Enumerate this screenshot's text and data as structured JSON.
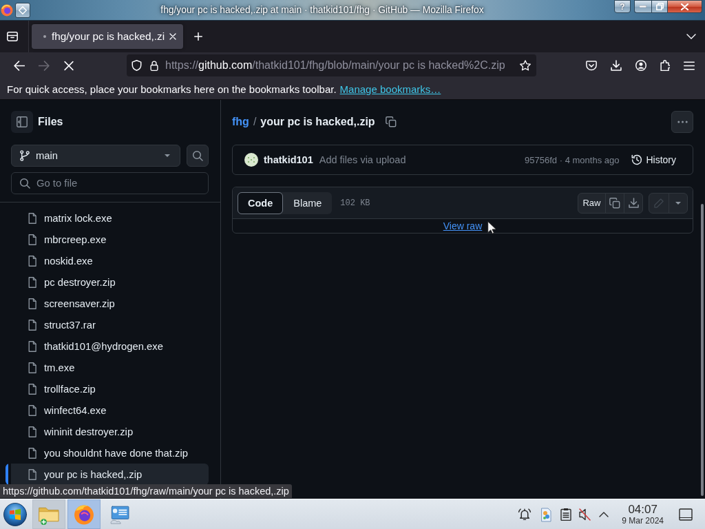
{
  "window": {
    "title": "fhg/your pc is hacked,.zip at main · thatkid101/fhg · GitHub — Mozilla Firefox",
    "help": "?"
  },
  "tabs": [
    {
      "title": "fhg/your pc is hacked,.zi",
      "selected": true
    }
  ],
  "nav_buttons": [
    {
      "kind": "back",
      "disabled": false
    },
    {
      "kind": "forward",
      "disabled": true
    },
    {
      "kind": "stop",
      "disabled": false
    }
  ],
  "address_bar": {
    "scheme": "https://",
    "host": "github.com",
    "path": "/thatkid101/fhg/blob/main/your pc is hacked%2C.zip"
  },
  "bookmarks_bar": {
    "message": "For quick access, place your bookmarks here on the bookmarks toolbar.",
    "link": "Manage bookmarks…"
  },
  "sidebar": {
    "title": "Files",
    "branch": "main",
    "search": {
      "placeholder": "Go to file"
    },
    "files": [
      {
        "name": "matrix lock.exe",
        "selected": false
      },
      {
        "name": "mbrcreep.exe",
        "selected": false
      },
      {
        "name": "noskid.exe",
        "selected": false
      },
      {
        "name": "pc destroyer.zip",
        "selected": false
      },
      {
        "name": "screensaver.zip",
        "selected": false
      },
      {
        "name": "struct37.rar",
        "selected": false
      },
      {
        "name": "thatkid101@hydrogen.exe",
        "selected": false
      },
      {
        "name": "tm.exe",
        "selected": false
      },
      {
        "name": "trollface.zip",
        "selected": false
      },
      {
        "name": "winfect64.exe",
        "selected": false
      },
      {
        "name": "wininit destroyer.zip",
        "selected": false
      },
      {
        "name": "you shouldnt have done that.zip",
        "selected": false
      },
      {
        "name": "your pc is hacked,.zip",
        "selected": true
      }
    ]
  },
  "breadcrumb": {
    "repo": "fhg",
    "separator": "/",
    "file": "your pc is hacked,.zip"
  },
  "commit": {
    "author": "thatkid101",
    "message": "Add files via upload",
    "info": "95756fd · 4 months ago",
    "history": "History"
  },
  "file_view": {
    "tabs": [
      {
        "label": "Code",
        "selected": true
      },
      {
        "label": "Blame",
        "selected": false
      }
    ],
    "size": "102 KB",
    "raw": "Raw",
    "edit_disabled": true,
    "view_raw": "View raw"
  },
  "status_url": "https://github.com/thatkid101/fhg/raw/main/your pc is hacked,.zip",
  "taskbar": {
    "apps": [
      {
        "kind": "folder",
        "running": true,
        "selected": false
      },
      {
        "kind": "browser",
        "running": true,
        "selected": true
      },
      {
        "kind": "monitor",
        "running": false,
        "selected": false
      }
    ],
    "tray": {
      "muted": true
    },
    "clock": {
      "time": "04:07",
      "date": "9 Mar 2024"
    }
  }
}
